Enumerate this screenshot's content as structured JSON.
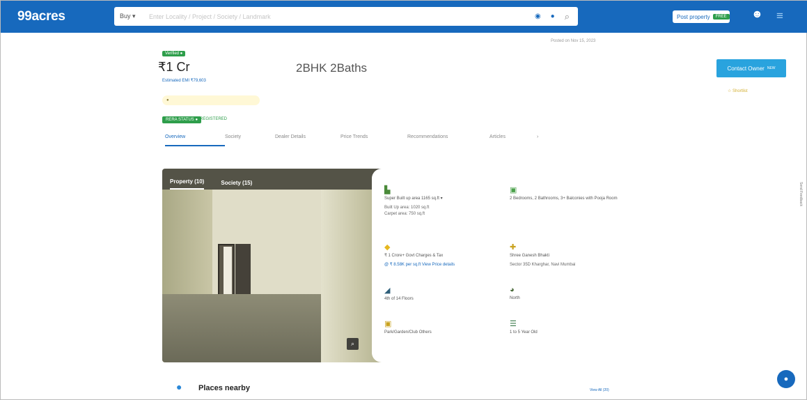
{
  "header": {
    "logo": "99acres",
    "buy_label": "Buy ▾",
    "search_placeholder": "Enter Locality / Project / Society / Landmark",
    "post_property_label": "Post property",
    "post_property_badge": "FREE",
    "account_icon": "account-icon",
    "menu_icon": "menu-icon"
  },
  "listing": {
    "verified_badge": "Verified ●",
    "price": "₹1 Cr",
    "emi_link": "Estimated EMI ₹79,603",
    "config_title": "2BHK 2Baths",
    "posted_info": "Posted on Nov 15, 2023",
    "rera_badge": "RERA STATUS ●",
    "rera_text": "REGISTERED",
    "contact_button": "Contact Owner",
    "contact_badge": "NEW",
    "shortlist_label": "☆ Shortlist",
    "send_feedback": "Send Feedback"
  },
  "tabs": [
    "Overview",
    "Society",
    "Dealer Details",
    "Price Trends",
    "Recommendations",
    "Articles",
    "›"
  ],
  "photo": {
    "tabs": [
      "Property (10)",
      "Society (15)"
    ],
    "zoom_icon": "zoom-icon"
  },
  "details": [
    {
      "icon": "area-icon",
      "value": "Super Built up area 1165 sq.ft ▾",
      "sub": "Built Up area: 1020 sq.ft\nCarpet area: 750 sq.ft"
    },
    {
      "icon": "config-icon",
      "value": "2 Bedrooms, 2 Bathrooms, 3+ Balconies with Pooja Room",
      "sub": ""
    },
    {
      "icon": "price-icon",
      "value": "₹ 1 Crore+ Govt Charges & Tax",
      "sub": "@ ₹ 8.58K per sq.ft  View Price details"
    },
    {
      "icon": "address-icon",
      "value": "Shree Ganesh Bhakti",
      "sub": "Sector 35D Kharghar, Navi Mumbai"
    },
    {
      "icon": "floor-icon",
      "value": "4th of 14 Floors",
      "sub": ""
    },
    {
      "icon": "facing-icon",
      "value": "North",
      "sub": ""
    },
    {
      "icon": "overlooking-icon",
      "value": "Park/Garden/Club Others",
      "sub": ""
    },
    {
      "icon": "age-icon",
      "value": "1 to 5 Year Old",
      "sub": ""
    }
  ],
  "places": {
    "title": "Places nearby",
    "view_all": "View All (20)"
  },
  "colors": {
    "brand": "#1769bd",
    "green": "#2e9e4b",
    "contact": "#29a3de"
  }
}
